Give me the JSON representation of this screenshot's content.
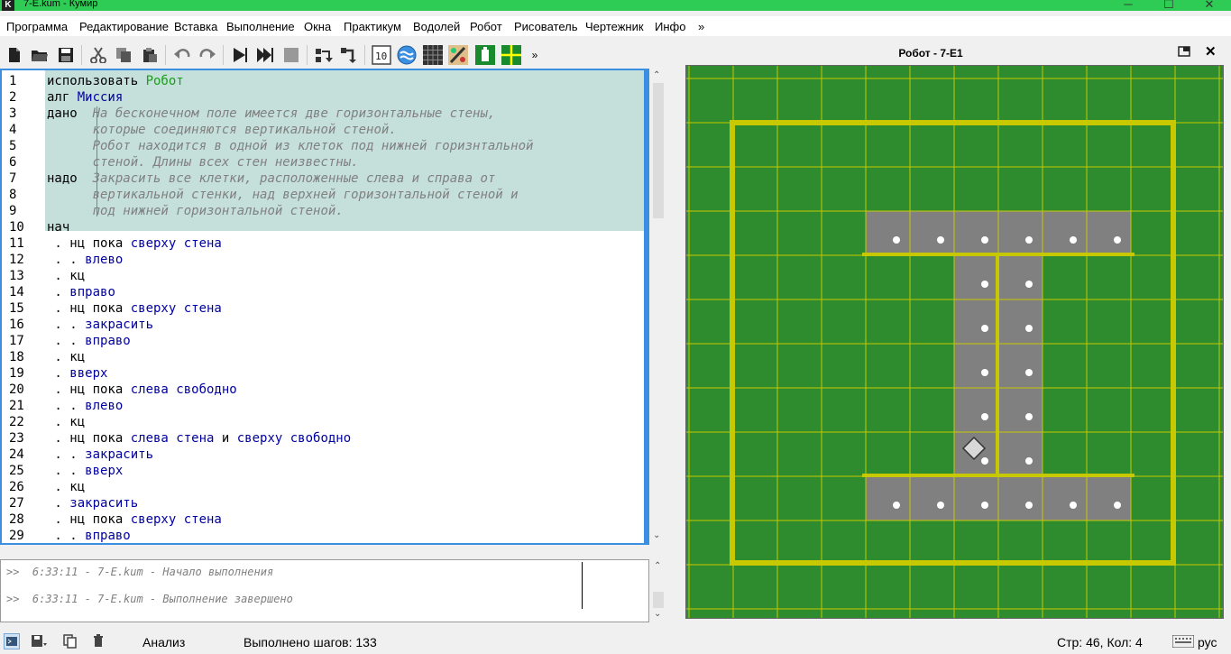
{
  "window": {
    "title": "7-E.kum - Кумир",
    "app_icon": "K"
  },
  "menu": [
    "Программа",
    "Редактирование",
    "Вставка",
    "Выполнение",
    "Окна",
    "Практикум",
    "Водолей",
    "Робот",
    "Рисователь",
    "Чертежник",
    "Инфо",
    "»"
  ],
  "toolbar": {
    "more": "»"
  },
  "editor": {
    "lines": [
      {
        "n": "1",
        "parts": [
          [
            "kw",
            "использовать "
          ],
          [
            "gr",
            "Робот"
          ]
        ]
      },
      {
        "n": "2",
        "parts": [
          [
            "kw",
            "алг "
          ],
          [
            "nm",
            "Миссия"
          ]
        ]
      },
      {
        "n": "3",
        "parts": [
          [
            "kw",
            "дано  "
          ],
          [
            "cm",
            "На бесконечном поле имеется две горизонтальные стены,"
          ]
        ]
      },
      {
        "n": "4",
        "parts": [
          [
            "kw",
            "      "
          ],
          [
            "cm",
            "которые соединяются вертикальной стеной."
          ]
        ]
      },
      {
        "n": "5",
        "parts": [
          [
            "kw",
            "      "
          ],
          [
            "cm",
            "Робот находится в одной из клеток под нижней горизнтальной"
          ]
        ]
      },
      {
        "n": "6",
        "parts": [
          [
            "kw",
            "      "
          ],
          [
            "cm",
            "стеной. Длины всех стен неизвестны."
          ]
        ]
      },
      {
        "n": "7",
        "parts": [
          [
            "kw",
            "надо  "
          ],
          [
            "cm",
            "Закрасить все клетки, расположенные слева и справа от"
          ]
        ]
      },
      {
        "n": "8",
        "parts": [
          [
            "kw",
            "      "
          ],
          [
            "cm",
            "вертикальной стенки, над верхней горизонтальной стеной и"
          ]
        ]
      },
      {
        "n": "9",
        "parts": [
          [
            "kw",
            "      "
          ],
          [
            "cm",
            "под нижней горизонтальной стеной."
          ]
        ]
      },
      {
        "n": "10",
        "parts": [
          [
            "kw",
            "нач"
          ]
        ]
      },
      {
        "n": "11",
        "parts": [
          [
            "kw",
            " . нц пока "
          ],
          [
            "nm",
            "сверху стена"
          ]
        ]
      },
      {
        "n": "12",
        "parts": [
          [
            "kw",
            " . . "
          ],
          [
            "nm",
            "влево"
          ]
        ]
      },
      {
        "n": "13",
        "parts": [
          [
            "kw",
            " . кц"
          ]
        ]
      },
      {
        "n": "14",
        "parts": [
          [
            "kw",
            " . "
          ],
          [
            "nm",
            "вправо"
          ]
        ]
      },
      {
        "n": "15",
        "parts": [
          [
            "kw",
            " . нц пока "
          ],
          [
            "nm",
            "сверху стена"
          ]
        ]
      },
      {
        "n": "16",
        "parts": [
          [
            "kw",
            " . . "
          ],
          [
            "nm",
            "закрасить"
          ]
        ]
      },
      {
        "n": "17",
        "parts": [
          [
            "kw",
            " . . "
          ],
          [
            "nm",
            "вправо"
          ]
        ]
      },
      {
        "n": "18",
        "parts": [
          [
            "kw",
            " . кц"
          ]
        ]
      },
      {
        "n": "19",
        "parts": [
          [
            "kw",
            " . "
          ],
          [
            "nm",
            "вверх"
          ]
        ]
      },
      {
        "n": "20",
        "parts": [
          [
            "kw",
            " . нц пока "
          ],
          [
            "nm",
            "слева свободно"
          ]
        ]
      },
      {
        "n": "21",
        "parts": [
          [
            "kw",
            " . . "
          ],
          [
            "nm",
            "влево"
          ]
        ]
      },
      {
        "n": "22",
        "parts": [
          [
            "kw",
            " . кц"
          ]
        ]
      },
      {
        "n": "23",
        "parts": [
          [
            "kw",
            " . нц пока "
          ],
          [
            "nm",
            "слева стена "
          ],
          [
            "kw",
            "и "
          ],
          [
            "nm",
            "сверху свободно"
          ]
        ]
      },
      {
        "n": "24",
        "parts": [
          [
            "kw",
            " . . "
          ],
          [
            "nm",
            "закрасить"
          ]
        ]
      },
      {
        "n": "25",
        "parts": [
          [
            "kw",
            " . . "
          ],
          [
            "nm",
            "вверх"
          ]
        ]
      },
      {
        "n": "26",
        "parts": [
          [
            "kw",
            " . кц"
          ]
        ]
      },
      {
        "n": "27",
        "parts": [
          [
            "kw",
            " . "
          ],
          [
            "nm",
            "закрасить"
          ]
        ]
      },
      {
        "n": "28",
        "parts": [
          [
            "kw",
            " . нц пока "
          ],
          [
            "nm",
            "сверху стена"
          ]
        ]
      },
      {
        "n": "29",
        "parts": [
          [
            "kw",
            " . . "
          ],
          [
            "nm",
            "вправо"
          ]
        ]
      }
    ]
  },
  "console": {
    "messages": [
      ">>  6:33:11 - 7-E.kum - Начало выполнения",
      ">>  6:33:11 - 7-E.kum - Выполнение завершено"
    ]
  },
  "robot_panel": {
    "title": "Робот  - 7-E1",
    "field": {
      "cols": 12,
      "rows": 12,
      "painted": [
        [
          3,
          2
        ],
        [
          4,
          2
        ],
        [
          5,
          2
        ],
        [
          6,
          2
        ],
        [
          7,
          2
        ],
        [
          8,
          2
        ],
        [
          5,
          3
        ],
        [
          6,
          3
        ],
        [
          5,
          4
        ],
        [
          6,
          4
        ],
        [
          5,
          5
        ],
        [
          6,
          5
        ],
        [
          5,
          6
        ],
        [
          6,
          6
        ],
        [
          5,
          7
        ],
        [
          6,
          7
        ],
        [
          3,
          8
        ],
        [
          4,
          8
        ],
        [
          5,
          8
        ],
        [
          6,
          8
        ],
        [
          7,
          8
        ],
        [
          8,
          8
        ]
      ],
      "marked": [
        [
          3,
          2
        ],
        [
          4,
          2
        ],
        [
          5,
          2
        ],
        [
          6,
          2
        ],
        [
          7,
          2
        ],
        [
          8,
          2
        ],
        [
          5,
          3
        ],
        [
          6,
          3
        ],
        [
          5,
          4
        ],
        [
          6,
          4
        ],
        [
          5,
          5
        ],
        [
          6,
          5
        ],
        [
          5,
          6
        ],
        [
          6,
          6
        ],
        [
          5,
          7
        ],
        [
          6,
          7
        ],
        [
          3,
          8
        ],
        [
          4,
          8
        ],
        [
          5,
          8
        ],
        [
          6,
          8
        ],
        [
          7,
          8
        ],
        [
          8,
          8
        ]
      ],
      "robot": [
        5,
        7
      ],
      "colors": {
        "field": "#2e8b2e",
        "grid": "#c8c800",
        "painted": "#808080",
        "wall": "#c8c800"
      }
    }
  },
  "status": {
    "mode": "Анализ",
    "steps": "Выполнено шагов: 133",
    "position": "Стр: 46, Кол: 4",
    "lang": "рус"
  }
}
